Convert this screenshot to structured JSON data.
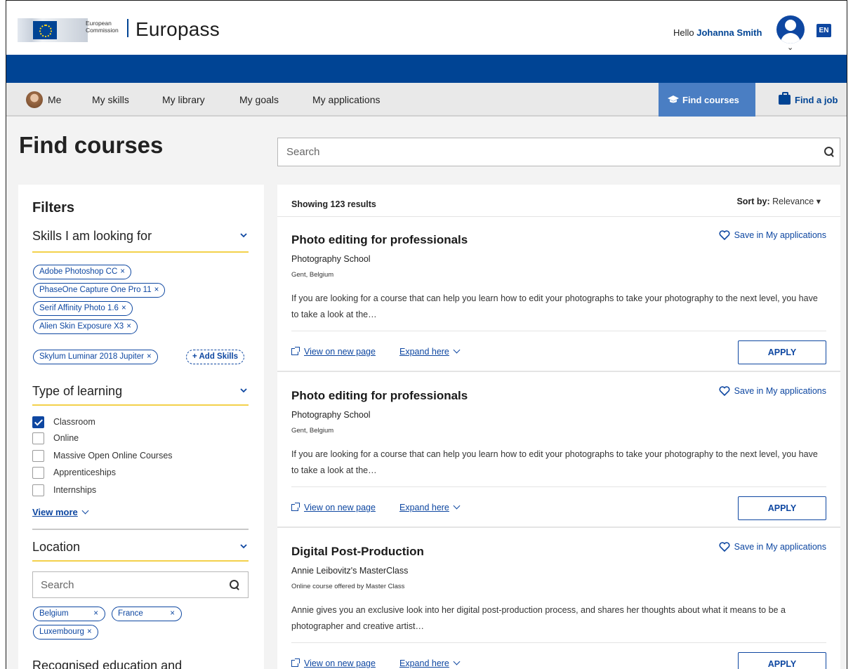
{
  "header": {
    "org_line1": "European",
    "org_line2": "Commission",
    "brand": "Europass",
    "greeting": "Hello",
    "user_name": "Johanna Smith",
    "language": "EN"
  },
  "nav": {
    "items": [
      "Me",
      "My skills",
      "My library",
      "My goals",
      "My applications"
    ],
    "find_courses": "Find courses",
    "find_job": "Find a job"
  },
  "page": {
    "title": "Find courses",
    "search_placeholder": "Search"
  },
  "filters": {
    "title": "Filters",
    "skills": {
      "label": "Skills I am looking for",
      "chips": [
        "Adobe Photoshop CC",
        "PhaseOne Capture One Pro 11",
        "Serif Affinity Photo 1.6",
        "Alien Skin Exposure X3",
        "Skylum Luminar 2018 Jupiter"
      ],
      "add_label": "+ Add Skills"
    },
    "type_of_learning": {
      "label": "Type of learning",
      "options": [
        {
          "label": "Classroom",
          "checked": true
        },
        {
          "label": "Online",
          "checked": false
        },
        {
          "label": "Massive Open Online Courses",
          "checked": false
        },
        {
          "label": "Apprenticeships",
          "checked": false
        },
        {
          "label": "Internships",
          "checked": false
        }
      ],
      "view_more": "View more"
    },
    "location": {
      "label": "Location",
      "search_placeholder": "Search",
      "chips": [
        "Belgium",
        "France",
        "Luxembourg"
      ]
    },
    "next_section_partial": "Recognised education and"
  },
  "results": {
    "showing": "Showing 123 results",
    "sort_label": "Sort by:",
    "sort_value": "Relevance",
    "cards": [
      {
        "title": "Photo editing for professionals",
        "provider": "Photography School",
        "location": "Gent, Belgium",
        "description": "If you are looking for a course that can help you learn how to edit your photographs to take your photography to the next level, you have to take a look at the…",
        "save": "Save in My applications",
        "view": "View on new page",
        "expand": "Expand here",
        "apply": "APPLY"
      },
      {
        "title": "Photo editing for professionals",
        "provider": "Photography School",
        "location": "Gent, Belgium",
        "description": "If you are looking for a course that can help you learn how to edit your photographs to take your photography to the next level, you have to take a look at the…",
        "save": "Save in My applications",
        "view": "View on new page",
        "expand": "Expand here",
        "apply": "APPLY"
      },
      {
        "title": "Digital Post-Production",
        "provider": "Annie Leibovitz's MasterClass",
        "location": "Online course offered by Master Class",
        "description": "Annie gives you an exclusive look into her digital post-production process, and shares her thoughts about what it means to be a photographer and creative artist…",
        "save": "Save in My applications",
        "view": "View on new page",
        "expand": "Expand here",
        "apply": "APPLY"
      }
    ]
  },
  "colors": {
    "primary_blue": "#004494",
    "accent_blue": "#0e47a1",
    "active_tab": "#4a7ec3",
    "filter_rule_yellow": "#f3d14b"
  }
}
